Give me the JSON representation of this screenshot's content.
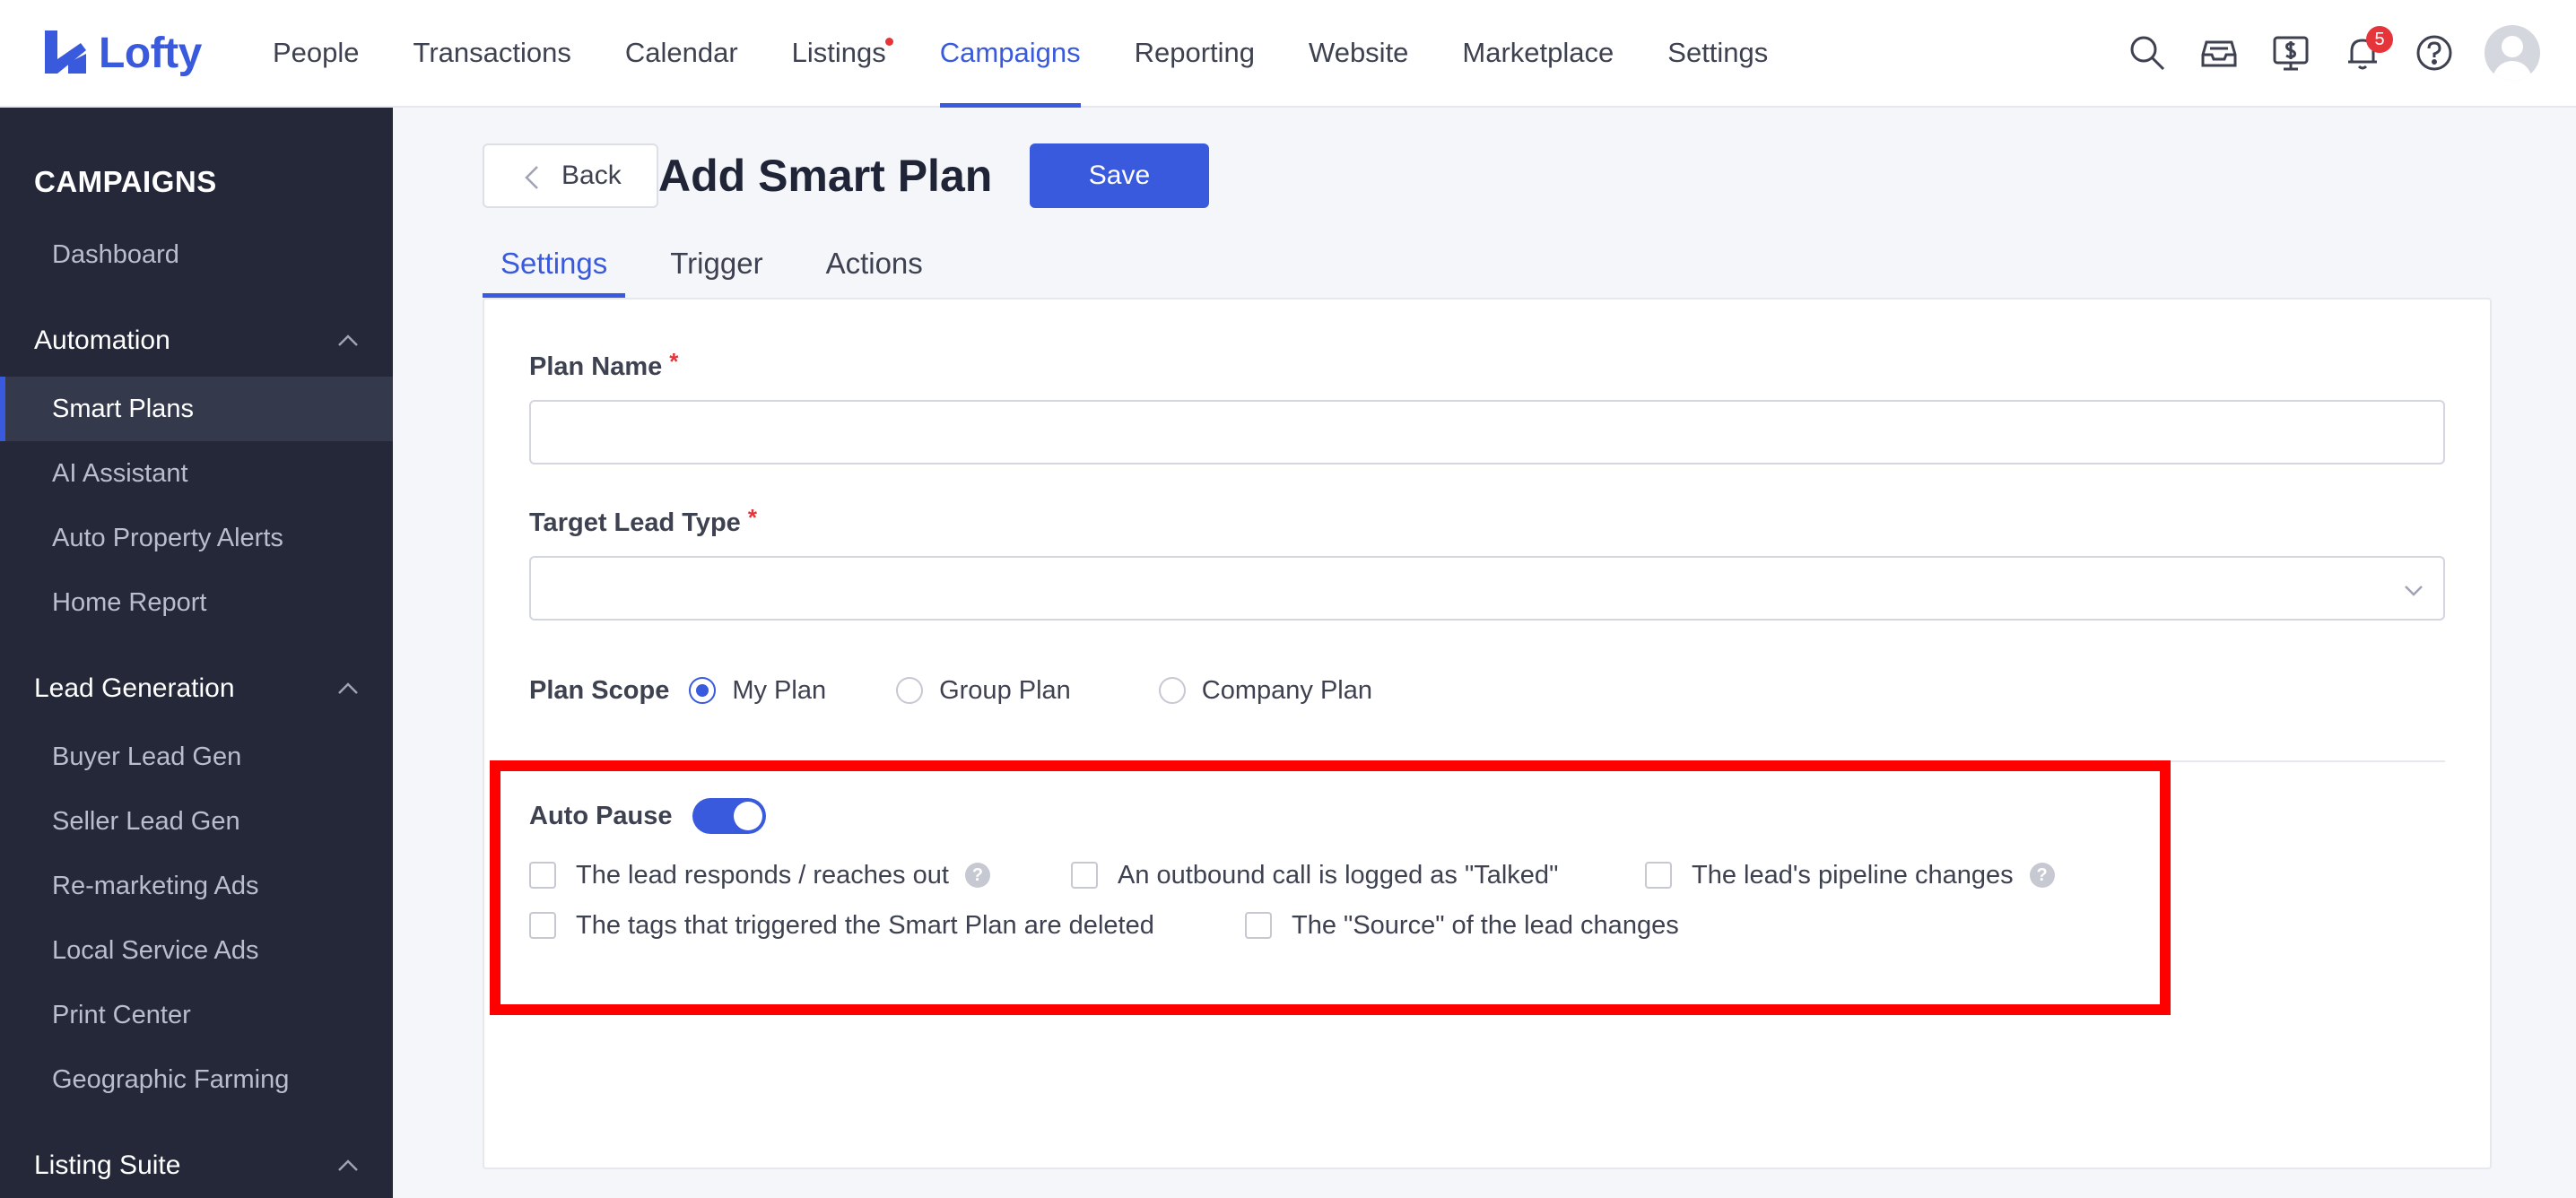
{
  "brand": {
    "name": "Lofty",
    "color": "#3a5ade"
  },
  "nav": {
    "items": [
      {
        "label": "People"
      },
      {
        "label": "Transactions"
      },
      {
        "label": "Calendar"
      },
      {
        "label": "Listings"
      },
      {
        "label": "Campaigns"
      },
      {
        "label": "Reporting"
      },
      {
        "label": "Website"
      },
      {
        "label": "Marketplace"
      },
      {
        "label": "Settings"
      }
    ],
    "active": "Campaigns",
    "notification_count": "5",
    "icons": [
      "search-icon",
      "inbox-icon",
      "billing-icon",
      "bell-icon",
      "help-icon",
      "avatar"
    ]
  },
  "sidebar": {
    "title": "CAMPAIGNS",
    "dashboard": "Dashboard",
    "automation": {
      "label": "Automation",
      "items": [
        "Smart Plans",
        "AI Assistant",
        "Auto Property Alerts",
        "Home Report"
      ]
    },
    "lead_generation": {
      "label": "Lead Generation",
      "items": [
        "Buyer Lead Gen",
        "Seller Lead Gen",
        "Re-marketing Ads",
        "Local Service Ads",
        "Print Center",
        "Geographic Farming"
      ]
    },
    "listing_suite": {
      "label": "Listing Suite"
    },
    "active_item": "Smart Plans"
  },
  "page": {
    "back_label": "Back",
    "title": "Add Smart Plan",
    "save_label": "Save",
    "tabs": [
      "Settings",
      "Trigger",
      "Actions"
    ],
    "active_tab": "Settings"
  },
  "form": {
    "plan_name": {
      "label": "Plan Name",
      "required": "*",
      "value": "",
      "placeholder": ""
    },
    "target_lead_type": {
      "label": "Target Lead Type",
      "required": "*",
      "value": ""
    },
    "plan_scope": {
      "label": "Plan Scope",
      "options": [
        "My Plan",
        "Group Plan",
        "Company Plan"
      ],
      "selected": "My Plan"
    },
    "auto_pause": {
      "label": "Auto Pause",
      "enabled": true,
      "conditions": [
        {
          "label": "The lead responds / reaches out",
          "checked": false
        },
        {
          "label": "An outbound call is logged as \"Talked\"",
          "checked": false
        },
        {
          "label": "The lead's pipeline changes",
          "checked": false
        },
        {
          "label": "The tags that triggered the Smart Plan are deleted",
          "checked": false
        },
        {
          "label": "The \"Source\" of the lead changes",
          "checked": false
        }
      ]
    }
  },
  "colors": {
    "accent": "#3a5ade",
    "sidebar_bg": "#242838",
    "required": "#e6353a",
    "highlight": "#ff0000"
  }
}
